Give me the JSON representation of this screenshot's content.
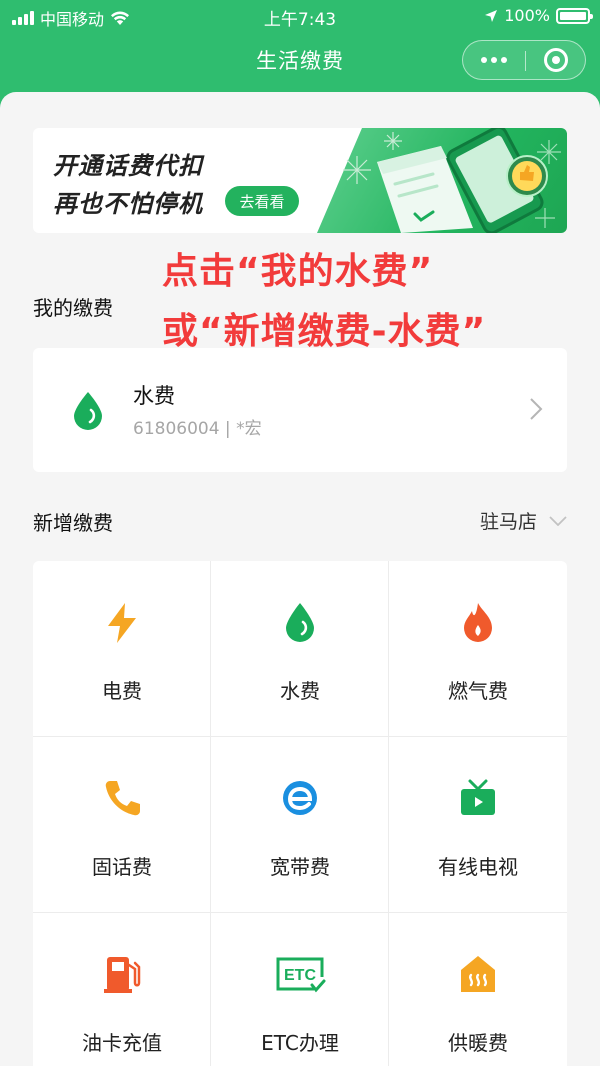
{
  "status_bar": {
    "carrier": "中国移动",
    "time": "上午7:43",
    "battery": "100%"
  },
  "nav": {
    "title": "生活缴费"
  },
  "banner": {
    "line1": "开通话费代扣",
    "line2": "再也不怕停机",
    "button": "去看看"
  },
  "annotation": {
    "line1": "点击“我的水费”",
    "line2": "或“新增缴费-水费”"
  },
  "my_bills": {
    "title": "我的缴费",
    "items": [
      {
        "name": "水费",
        "account": "61806004 | *宏",
        "icon": "water-drop-icon"
      }
    ]
  },
  "new_payment": {
    "title": "新增缴费",
    "region": "驻马店",
    "items": [
      {
        "label": "电费",
        "icon": "lightning-icon",
        "color": "#f5a623"
      },
      {
        "label": "水费",
        "icon": "water-drop-icon",
        "color": "#1aad5b"
      },
      {
        "label": "燃气费",
        "icon": "flame-icon",
        "color": "#f05a2c"
      },
      {
        "label": "固话费",
        "icon": "phone-icon",
        "color": "#f5a623"
      },
      {
        "label": "宽带费",
        "icon": "broadband-icon",
        "color": "#1a8fe0"
      },
      {
        "label": "有线电视",
        "icon": "tv-icon",
        "color": "#1aad5b"
      },
      {
        "label": "油卡充值",
        "icon": "fuel-icon",
        "color": "#f05a2c"
      },
      {
        "label": "ETC办理",
        "icon": "etc-icon",
        "color": "#1aad5b"
      },
      {
        "label": "供暖费",
        "icon": "heating-icon",
        "color": "#f5a623"
      }
    ]
  },
  "colors": {
    "brand_green": "#2fbd6f",
    "annotation_red": "#f23b3b"
  }
}
